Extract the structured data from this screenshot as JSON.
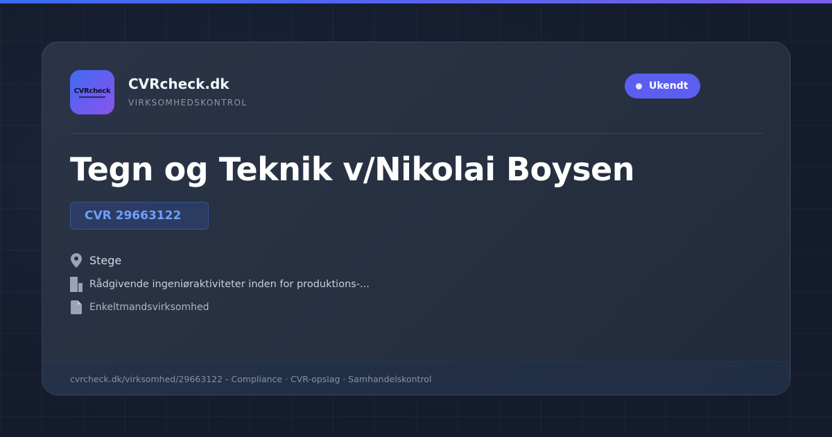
{
  "brand": {
    "logo_text": "CVRcheck",
    "name": "CVRcheck.dk",
    "tagline": "VIRKSOMHEDSKONTROL"
  },
  "status": {
    "label": "Ukendt"
  },
  "company": {
    "name": "Tegn og Teknik v/Nikolai Boysen",
    "cvr": "CVR 29663122",
    "city": "Stege",
    "industry": "Rådgivende ingeniøraktiviteter inden for produktions-...",
    "type": "Enkeltmandsvirksomhed"
  },
  "footer": {
    "text": "cvrcheck.dk/virksomhed/29663122 - Compliance · CVR-opslag · Samhandelskontrol"
  },
  "icons": {
    "city": "location-pin-icon",
    "industry": "building-icon",
    "type": "document-icon"
  },
  "colors": {
    "accent": "#5b5ef0",
    "cvr": "#6ea0ff",
    "background": "#131b2c"
  }
}
